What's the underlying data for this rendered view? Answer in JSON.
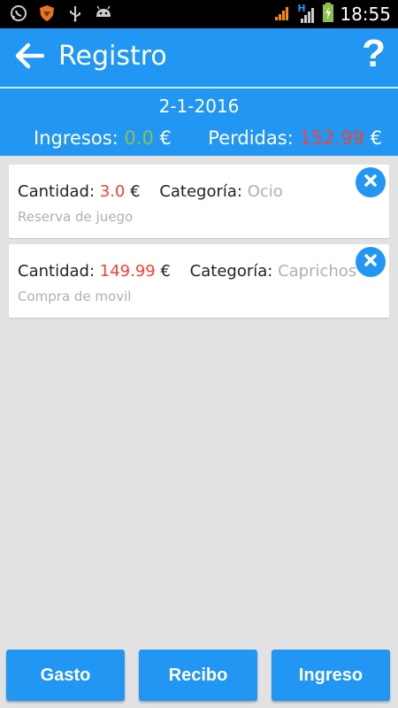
{
  "status_bar": {
    "time": "18:55",
    "icons": [
      "whatsapp-icon",
      "shield-app-icon",
      "usb-icon",
      "android-icon",
      "signal-icon",
      "hspa-signal-icon",
      "battery-charging-icon"
    ],
    "network_label": "H"
  },
  "app_bar": {
    "title": "Registro",
    "back_icon": "arrow-left-icon",
    "help_label": "?"
  },
  "summary": {
    "date": "2-1-2016",
    "income_label": "Ingresos:",
    "income_value": "0.0",
    "loss_label": "Perdidas:",
    "loss_value": "152.99",
    "currency": "€"
  },
  "entries": [
    {
      "amount_label": "Cantidad:",
      "amount": "3.0",
      "currency": "€",
      "category_label": "Categoría:",
      "category": "Ocio",
      "description": "Reserva de juego"
    },
    {
      "amount_label": "Cantidad:",
      "amount": "149.99",
      "currency": "€",
      "category_label": "Categoría:",
      "category": "Caprichos",
      "description": "Compra de movil"
    }
  ],
  "buttons": {
    "gasto": "Gasto",
    "recibo": "Recibo",
    "ingreso": "Ingreso"
  },
  "colors": {
    "primary": "#2196f3",
    "income": "#8bc34a",
    "loss": "#f44336",
    "background": "#e2e2e2"
  }
}
